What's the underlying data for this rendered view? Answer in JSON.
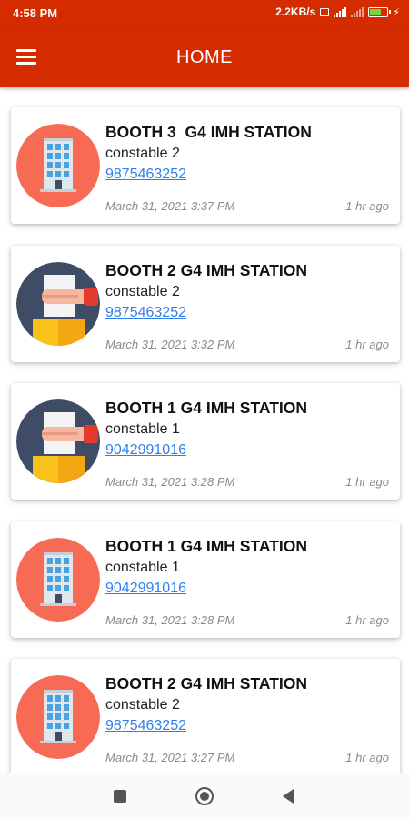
{
  "status_bar": {
    "time": "4:58 PM",
    "net_speed": "2.2KB/s",
    "battery_level": 0.7,
    "battery_color": "#7ad33a"
  },
  "app_bar": {
    "title": "HOME",
    "menu_icon": "hamburger-menu-icon",
    "color": "#d42c00"
  },
  "cards": [
    {
      "avatar": "building",
      "title": "BOOTH 3  G4 IMH STATION",
      "name": "constable 2",
      "phone": "9875463252",
      "date": "March 31, 2021 3:37 PM",
      "ago": "1 hr ago"
    },
    {
      "avatar": "hand-paper",
      "title": "BOOTH 2 G4 IMH STATION",
      "name": "constable 2",
      "phone": "9875463252",
      "date": "March 31, 2021 3:32 PM",
      "ago": "1 hr ago"
    },
    {
      "avatar": "hand-paper",
      "title": "BOOTH 1 G4 IMH STATION",
      "name": "constable 1",
      "phone": "9042991016",
      "date": "March 31, 2021 3:28 PM",
      "ago": "1 hr ago"
    },
    {
      "avatar": "building",
      "title": "BOOTH 1 G4 IMH STATION",
      "name": "constable 1",
      "phone": "9042991016",
      "date": "March 31, 2021 3:28 PM",
      "ago": "1 hr ago"
    },
    {
      "avatar": "building",
      "title": "BOOTH 2 G4 IMH STATION",
      "name": "constable 2",
      "phone": "9875463252",
      "date": "March 31, 2021 3:27 PM",
      "ago": "1 hr ago"
    }
  ],
  "nav_bar": {
    "recents_icon": "square-icon",
    "home_icon": "circle-icon",
    "back_icon": "triangle-back-icon"
  },
  "colors": {
    "building_bg": "#f76b55",
    "hand_bg": "#3f4c66",
    "link": "#2f80ed"
  }
}
